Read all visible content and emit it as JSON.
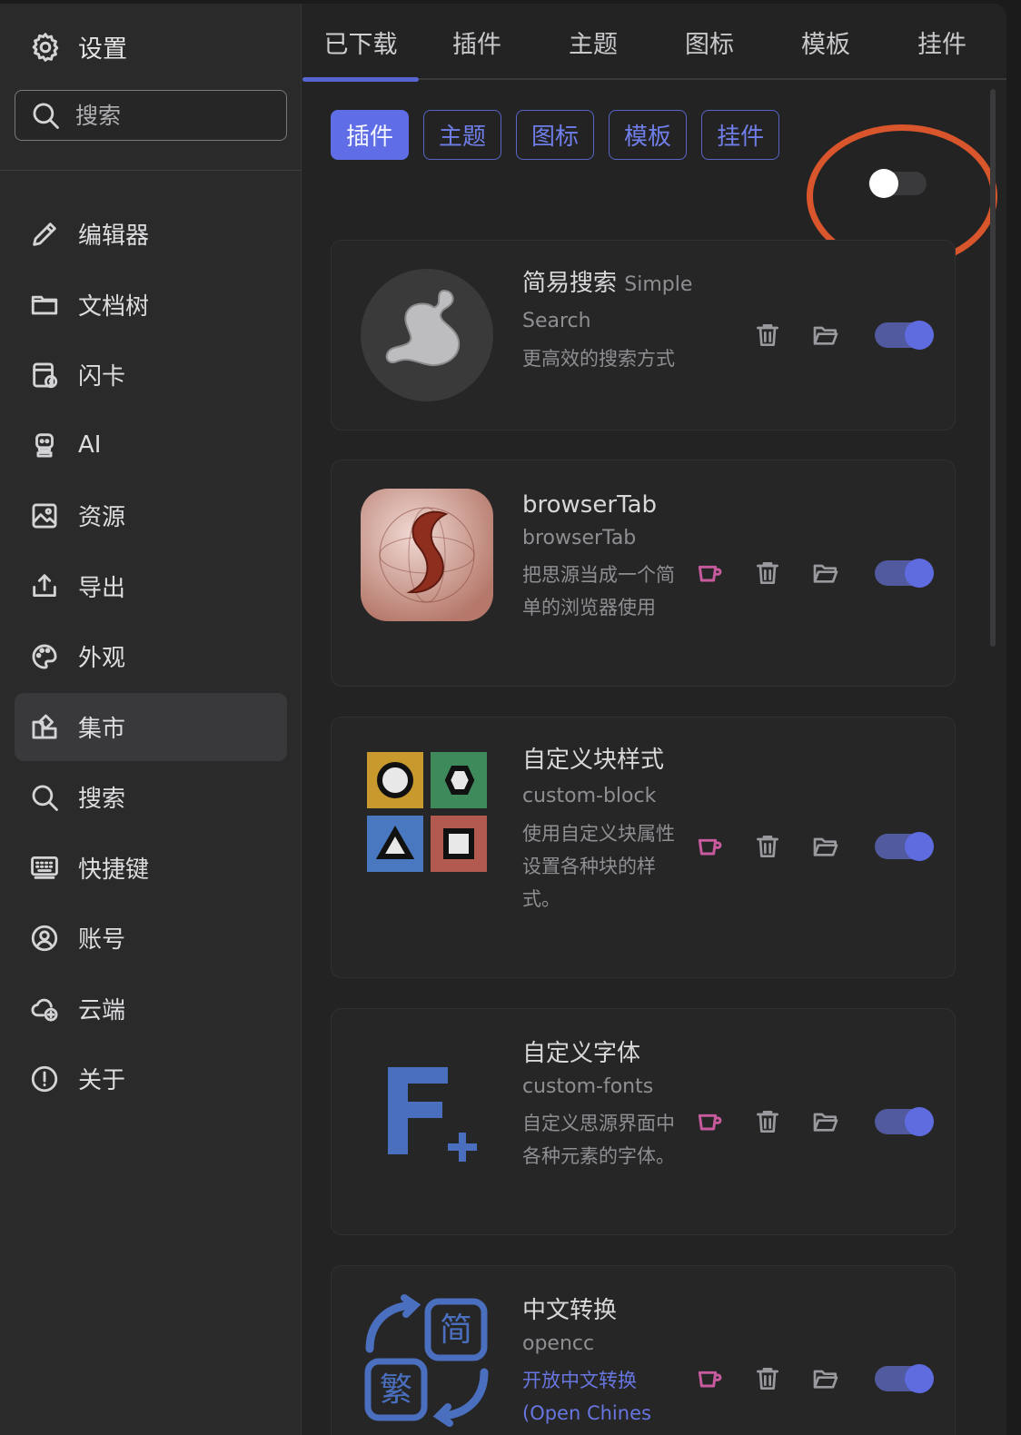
{
  "sidebar": {
    "title": "设置",
    "search_placeholder": "搜索",
    "items": [
      {
        "label": "编辑器"
      },
      {
        "label": "文档树"
      },
      {
        "label": "闪卡"
      },
      {
        "label": "AI"
      },
      {
        "label": "资源"
      },
      {
        "label": "导出"
      },
      {
        "label": "外观"
      },
      {
        "label": "集市"
      },
      {
        "label": "搜索"
      },
      {
        "label": "快捷键"
      },
      {
        "label": "账号"
      },
      {
        "label": "云端"
      },
      {
        "label": "关于"
      }
    ],
    "active_index": 7
  },
  "tabs": [
    {
      "label": "已下载"
    },
    {
      "label": "插件"
    },
    {
      "label": "主题"
    },
    {
      "label": "图标"
    },
    {
      "label": "模板"
    },
    {
      "label": "挂件"
    }
  ],
  "filters": [
    {
      "label": "插件"
    },
    {
      "label": "主题"
    },
    {
      "label": "图标"
    },
    {
      "label": "模板"
    },
    {
      "label": "挂件"
    }
  ],
  "colors": {
    "accent": "#5f6de6",
    "highlight_ring": "#d9552b",
    "donate_icon": "#c85a9e"
  },
  "plugins": [
    {
      "name": "简易搜索",
      "name_en": "Simple Search",
      "package": "",
      "description": "更高效的搜索方式",
      "enabled": true,
      "has_donate": false,
      "icon": "simple-search-logo"
    },
    {
      "name": "browserTab",
      "name_en": "",
      "package": "browserTab",
      "description": "把思源当成一个简单的浏览器使用",
      "enabled": true,
      "has_donate": true,
      "icon": "browser-tab-logo"
    },
    {
      "name": "自定义块样式",
      "name_en": "custom-block",
      "package": "",
      "description": "使用自定义块属性设置各种块的样式。",
      "enabled": true,
      "has_donate": true,
      "icon": "custom-block-logo"
    },
    {
      "name": "自定义字体",
      "name_en": "",
      "package": "custom-fonts",
      "description": "自定义思源界面中各种元素的字体。",
      "enabled": true,
      "has_donate": true,
      "icon": "custom-fonts-logo"
    },
    {
      "name": "中文转换",
      "name_en": "",
      "package": "opencc",
      "description": "开放中文转换(Open Chines",
      "enabled": true,
      "has_donate": true,
      "icon": "opencc-logo"
    }
  ],
  "icons": {
    "settings": "gear-icon",
    "search": "search-icon",
    "delete": "trash-icon",
    "folder": "folder-icon",
    "donate": "coffee-cup-icon"
  }
}
